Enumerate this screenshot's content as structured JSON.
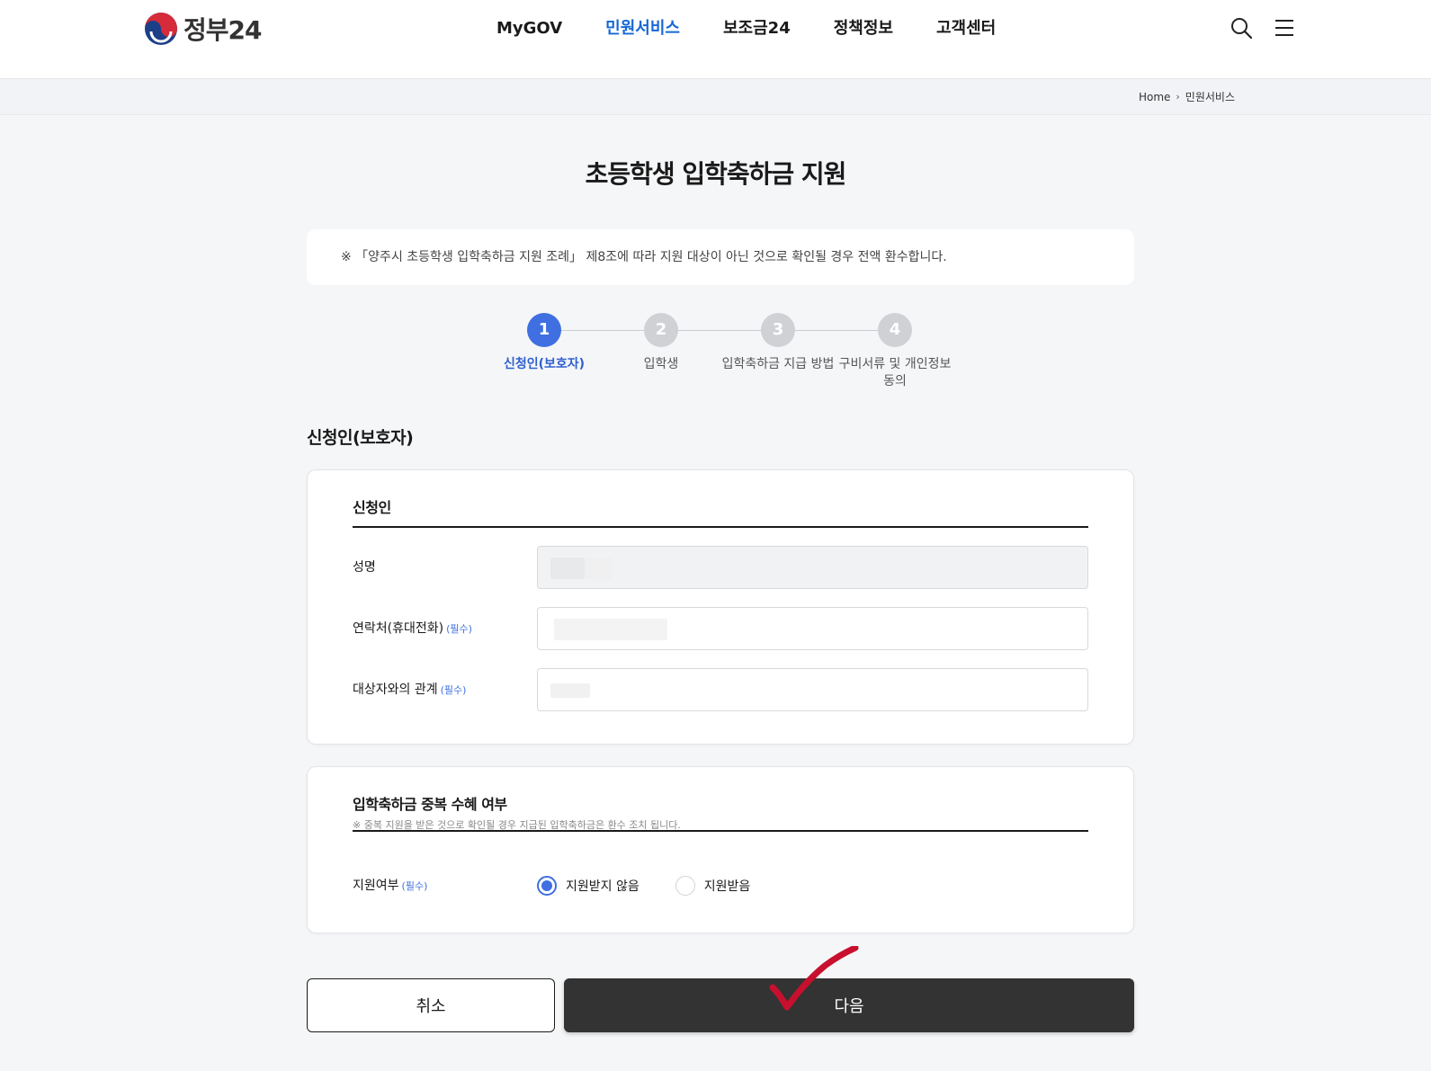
{
  "header": {
    "logo_text": "정부24",
    "nav": [
      "MyGOV",
      "민원서비스",
      "보조금24",
      "정책정보",
      "고객센터"
    ],
    "active_nav": "민원서비스"
  },
  "breadcrumb": {
    "home": "Home",
    "current": "민원서비스"
  },
  "page_title": "초등학생 입학축하금 지원",
  "notice": "※ 「양주시 초등학생 입학축하금 지원 조례」 제8조에 따라 지원 대상이 아닌 것으로 확인될 경우 전액 환수합니다.",
  "steps": [
    {
      "num": "1",
      "label": "신청인(보호자)"
    },
    {
      "num": "2",
      "label": "입학생"
    },
    {
      "num": "3",
      "label": "입학축하금 지급 방법"
    },
    {
      "num": "4",
      "label": "구비서류 및 개인정보 동의"
    }
  ],
  "section_title": "신청인(보호자)",
  "applicant": {
    "title": "신청인",
    "fields": [
      {
        "label": "성명",
        "required": ""
      },
      {
        "label": "연락처(휴대전화)",
        "required": "(필수)"
      },
      {
        "label": "대상자와의 관계",
        "required": "(필수)"
      }
    ]
  },
  "duplicate": {
    "title": "입학축하금 중복 수혜 여부",
    "note": "※ 중복 지원을 받은 것으로 확인될 경우 지급된 입학축하금은 환수 조치 됩니다.",
    "label": "지원여부",
    "required": "(필수)",
    "options": [
      "지원받지 않음",
      "지원받음"
    ],
    "selected": "지원받지 않음"
  },
  "buttons": {
    "cancel": "취소",
    "next": "다음"
  },
  "colors": {
    "primary": "#3f6fe0",
    "nav_active": "#1667d4",
    "next_button": "#333333",
    "checkmark": "#c8102e"
  }
}
